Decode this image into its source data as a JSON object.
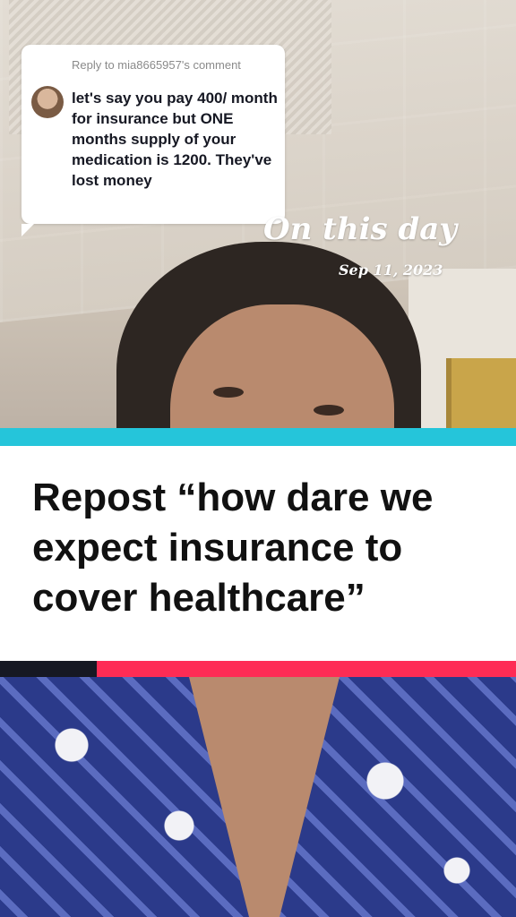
{
  "reply": {
    "header": "Reply to mia8665957's comment",
    "text": "let's say you pay 400/ month for insurance but ONE months supply of your medication is 1200. They've lost money"
  },
  "memory": {
    "title": "On this day",
    "date": "Sep 11, 2023"
  },
  "caption": {
    "text": "Repost “how dare we expect insurance to cover healthcare”"
  },
  "colors": {
    "accent_cyan": "#25c5da",
    "accent_red": "#fe2c55",
    "dark": "#161823"
  }
}
